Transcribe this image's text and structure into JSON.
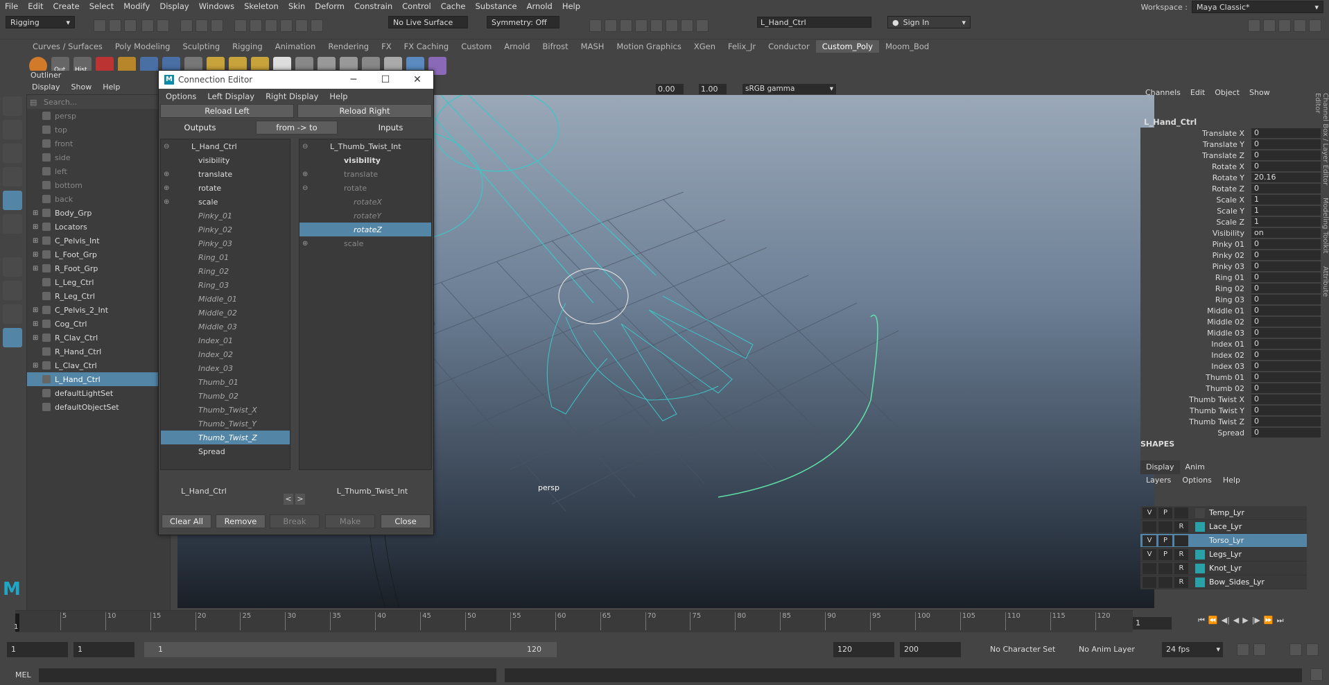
{
  "menubar": [
    "File",
    "Edit",
    "Create",
    "Select",
    "Modify",
    "Display",
    "Windows",
    "Skeleton",
    "Skin",
    "Deform",
    "Constrain",
    "Control",
    "Cache",
    "Substance",
    "Arnold",
    "Help"
  ],
  "workspace": {
    "label": "Workspace :",
    "value": "Maya Classic*"
  },
  "status": {
    "menuset": "Rigging",
    "live_surface": "No Live Surface",
    "symmetry": "Symmetry: Off",
    "search_value": "L_Hand_Ctrl",
    "signin": "Sign In"
  },
  "shelf_tabs": [
    "Curves / Surfaces",
    "Poly Modeling",
    "Sculpting",
    "Rigging",
    "Animation",
    "Rendering",
    "FX",
    "FX Caching",
    "Custom",
    "Arnold",
    "Bifrost",
    "MASH",
    "Motion Graphics",
    "XGen",
    "Felix_Jr",
    "Conductor",
    "Custom_Poly",
    "Moom_Bod"
  ],
  "shelf_active": "Custom_Poly",
  "shelf_labels": {
    "out": "Out",
    "hist": "Hist"
  },
  "outliner": {
    "title": "Outliner",
    "menu": [
      "Display",
      "Show",
      "Help"
    ],
    "search_placeholder": "Search...",
    "items": [
      {
        "label": "persp",
        "dim": true,
        "exp": ""
      },
      {
        "label": "top",
        "dim": true,
        "exp": ""
      },
      {
        "label": "front",
        "dim": true,
        "exp": ""
      },
      {
        "label": "side",
        "dim": true,
        "exp": ""
      },
      {
        "label": "left",
        "dim": true,
        "exp": ""
      },
      {
        "label": "bottom",
        "dim": true,
        "exp": ""
      },
      {
        "label": "back",
        "dim": true,
        "exp": ""
      },
      {
        "label": "Body_Grp",
        "exp": "⊞"
      },
      {
        "label": "Locators",
        "exp": "⊞"
      },
      {
        "label": "C_Pelvis_Int",
        "exp": "⊞"
      },
      {
        "label": "L_Foot_Grp",
        "exp": "⊞"
      },
      {
        "label": "R_Foot_Grp",
        "exp": "⊞"
      },
      {
        "label": "L_Leg_Ctrl",
        "exp": ""
      },
      {
        "label": "R_Leg_Ctrl",
        "exp": ""
      },
      {
        "label": "C_Pelvis_2_Int",
        "exp": "⊞"
      },
      {
        "label": "Cog_Ctrl",
        "exp": "⊞"
      },
      {
        "label": "R_Clav_Ctrl",
        "exp": "⊞"
      },
      {
        "label": "R_Hand_Ctrl",
        "exp": ""
      },
      {
        "label": "L_Clav_Ctrl",
        "exp": "⊞"
      },
      {
        "label": "L_Hand_Ctrl",
        "exp": "",
        "sel": true
      },
      {
        "label": "defaultLightSet",
        "exp": ""
      },
      {
        "label": "defaultObjectSet",
        "exp": ""
      }
    ]
  },
  "connection_editor": {
    "title": "Connection Editor",
    "menu": [
      "Options",
      "Left Display",
      "Right Display",
      "Help"
    ],
    "reload_left": "Reload Left",
    "reload_right": "Reload Right",
    "outputs": "Outputs",
    "from_to": "from -> to",
    "inputs": "Inputs",
    "left_node": "L_Hand_Ctrl",
    "right_node": "L_Thumb_Twist_Int",
    "left_items": [
      {
        "label": "L_Hand_Ctrl",
        "cls": "",
        "indent": 44,
        "plus": "⊖"
      },
      {
        "label": "visibility",
        "cls": "",
        "indent": 54,
        "plus": ""
      },
      {
        "label": "translate",
        "cls": "",
        "indent": 54,
        "plus": "⊕"
      },
      {
        "label": "rotate",
        "cls": "",
        "indent": 54,
        "plus": "⊕"
      },
      {
        "label": "scale",
        "cls": "",
        "indent": 54,
        "plus": "⊕"
      },
      {
        "label": "Pinky_01",
        "cls": "it",
        "indent": 54,
        "plus": ""
      },
      {
        "label": "Pinky_02",
        "cls": "it",
        "indent": 54,
        "plus": ""
      },
      {
        "label": "Pinky_03",
        "cls": "it",
        "indent": 54,
        "plus": ""
      },
      {
        "label": "Ring_01",
        "cls": "it",
        "indent": 54,
        "plus": ""
      },
      {
        "label": "Ring_02",
        "cls": "it",
        "indent": 54,
        "plus": ""
      },
      {
        "label": "Ring_03",
        "cls": "it",
        "indent": 54,
        "plus": ""
      },
      {
        "label": "Middle_01",
        "cls": "it",
        "indent": 54,
        "plus": ""
      },
      {
        "label": "Middle_02",
        "cls": "it",
        "indent": 54,
        "plus": ""
      },
      {
        "label": "Middle_03",
        "cls": "it",
        "indent": 54,
        "plus": ""
      },
      {
        "label": "Index_01",
        "cls": "it",
        "indent": 54,
        "plus": ""
      },
      {
        "label": "Index_02",
        "cls": "it",
        "indent": 54,
        "plus": ""
      },
      {
        "label": "Index_03",
        "cls": "it",
        "indent": 54,
        "plus": ""
      },
      {
        "label": "Thumb_01",
        "cls": "it",
        "indent": 54,
        "plus": ""
      },
      {
        "label": "Thumb_02",
        "cls": "it",
        "indent": 54,
        "plus": ""
      },
      {
        "label": "Thumb_Twist_X",
        "cls": "it",
        "indent": 54,
        "plus": ""
      },
      {
        "label": "Thumb_Twist_Y",
        "cls": "it",
        "indent": 54,
        "plus": ""
      },
      {
        "label": "Thumb_Twist_Z",
        "cls": "it sel",
        "indent": 54,
        "plus": ""
      },
      {
        "label": "Spread",
        "cls": "",
        "indent": 54,
        "plus": ""
      }
    ],
    "right_items": [
      {
        "label": "L_Thumb_Twist_Int",
        "cls": "",
        "indent": 44,
        "plus": "⊖"
      },
      {
        "label": "visibility",
        "cls": "b",
        "indent": 64,
        "plus": ""
      },
      {
        "label": "translate",
        "cls": "dim",
        "indent": 64,
        "plus": "⊕"
      },
      {
        "label": "rotate",
        "cls": "dim",
        "indent": 64,
        "plus": "⊖"
      },
      {
        "label": "rotateX",
        "cls": "dimi",
        "indent": 78,
        "plus": ""
      },
      {
        "label": "rotateY",
        "cls": "dimi",
        "indent": 78,
        "plus": ""
      },
      {
        "label": "rotateZ",
        "cls": "it sel",
        "indent": 78,
        "plus": ""
      },
      {
        "label": "scale",
        "cls": "dim",
        "indent": 64,
        "plus": "⊕"
      }
    ],
    "footer_left": "L_Hand_Ctrl",
    "footer_right": "L_Thumb_Twist_Int",
    "nav_prev": "<",
    "nav_next": ">",
    "btn_clear": "Clear All",
    "btn_remove": "Remove",
    "btn_break": "Break",
    "btn_make": "Make",
    "btn_close": "Close"
  },
  "viewport": {
    "camera": "persp",
    "exposure": "0.00",
    "gamma": "1.00",
    "colorspace": "sRGB gamma"
  },
  "channel_box": {
    "menu": [
      "Channels",
      "Edit",
      "Object",
      "Show"
    ],
    "node": "L_Hand_Ctrl",
    "channels": [
      {
        "label": "Translate X",
        "value": "0"
      },
      {
        "label": "Translate Y",
        "value": "0"
      },
      {
        "label": "Translate Z",
        "value": "0"
      },
      {
        "label": "Rotate X",
        "value": "0"
      },
      {
        "label": "Rotate Y",
        "value": "20.16"
      },
      {
        "label": "Rotate Z",
        "value": "0"
      },
      {
        "label": "Scale X",
        "value": "1"
      },
      {
        "label": "Scale Y",
        "value": "1"
      },
      {
        "label": "Scale Z",
        "value": "1"
      },
      {
        "label": "Visibility",
        "value": "on"
      },
      {
        "label": "Pinky 01",
        "value": "0"
      },
      {
        "label": "Pinky 02",
        "value": "0"
      },
      {
        "label": "Pinky 03",
        "value": "0"
      },
      {
        "label": "Ring 01",
        "value": "0"
      },
      {
        "label": "Ring 02",
        "value": "0"
      },
      {
        "label": "Ring 03",
        "value": "0"
      },
      {
        "label": "Middle 01",
        "value": "0"
      },
      {
        "label": "Middle 02",
        "value": "0"
      },
      {
        "label": "Middle 03",
        "value": "0"
      },
      {
        "label": "Index 01",
        "value": "0"
      },
      {
        "label": "Index 02",
        "value": "0"
      },
      {
        "label": "Index 03",
        "value": "0"
      },
      {
        "label": "Thumb 01",
        "value": "0"
      },
      {
        "label": "Thumb 02",
        "value": "0"
      },
      {
        "label": "Thumb Twist X",
        "value": "0"
      },
      {
        "label": "Thumb Twist Y",
        "value": "0"
      },
      {
        "label": "Thumb Twist Z",
        "value": "0"
      },
      {
        "label": "Spread",
        "value": "0"
      }
    ],
    "shapes": "SHAPES",
    "side_tabs": [
      "Channel Box / Layer Editor",
      "Modeling Toolkit",
      "Attribute Editor"
    ]
  },
  "layer_editor": {
    "tabs": [
      "Display",
      "Anim"
    ],
    "menu": [
      "Layers",
      "Options",
      "Help"
    ],
    "layers": [
      {
        "v": "V",
        "p": "P",
        "r": "",
        "name": "Temp_Lyr",
        "sel": false,
        "color": "#444444"
      },
      {
        "v": "",
        "p": "",
        "r": "R",
        "name": "Lace_Lyr",
        "sel": false,
        "color": "#2aa1a8"
      },
      {
        "v": "V",
        "p": "P",
        "r": "",
        "name": "Torso_Lyr",
        "sel": true,
        "color": "#5285a6"
      },
      {
        "v": "V",
        "p": "P",
        "r": "R",
        "name": "Legs_Lyr",
        "sel": false,
        "color": "#2aa1a8"
      },
      {
        "v": "",
        "p": "",
        "r": "R",
        "name": "Knot_Lyr",
        "sel": false,
        "color": "#2aa1a8"
      },
      {
        "v": "",
        "p": "",
        "r": "R",
        "name": "Bow_Sides_Lyr",
        "sel": false,
        "color": "#2aa1a8"
      }
    ]
  },
  "timeline": {
    "ticks": [
      "5",
      "10",
      "15",
      "20",
      "25",
      "30",
      "35",
      "40",
      "45",
      "50",
      "55",
      "60",
      "65",
      "70",
      "75",
      "80",
      "85",
      "90",
      "95",
      "100",
      "105",
      "110",
      "115",
      "120"
    ],
    "current_frame": "1",
    "current_field": "1"
  },
  "range": {
    "start": "1",
    "start2": "1",
    "slider_start": "1",
    "slider_end": "120",
    "end": "120",
    "end2": "200",
    "char_set": "No Character Set",
    "anim_layer": "No Anim Layer",
    "fps": "24 fps"
  },
  "cmd": {
    "label": "MEL"
  }
}
